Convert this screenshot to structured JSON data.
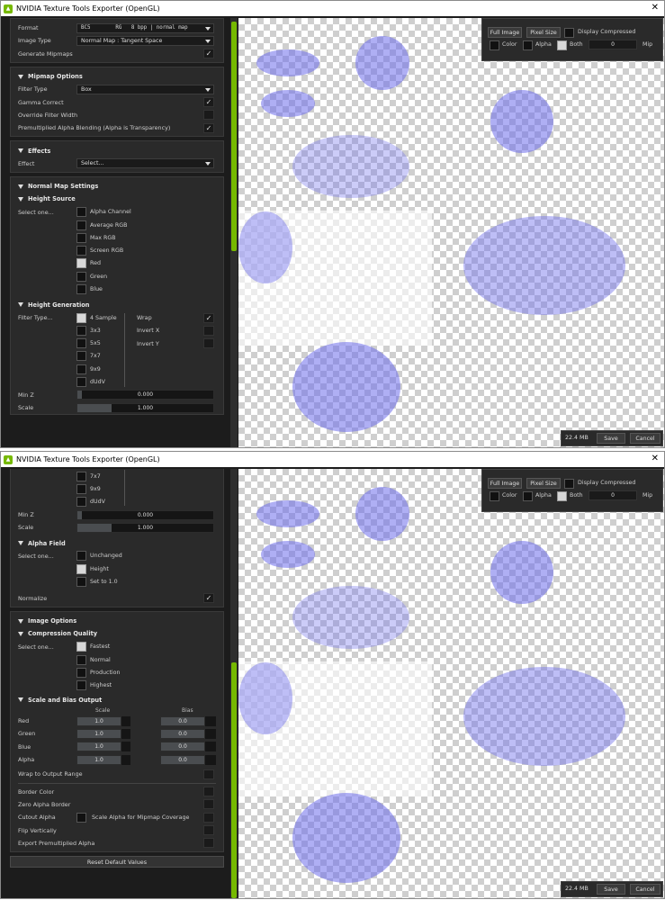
{
  "title": "NVIDIA Texture Tools Exporter (OpenGL)",
  "close": "✕",
  "nv_logo": "nvidia-logo",
  "accent": "#76b900",
  "tint": "#6e6eeb",
  "win1": {
    "format": {
      "label": "Format",
      "value": "BC5        RG   8 bpp | normal map"
    },
    "image_type": {
      "label": "Image Type",
      "value": "Normal Map : Tangent Space"
    },
    "gen_mips": {
      "label": "Generate Mipmaps",
      "check": "✓"
    },
    "mip_header": "Mipmap Options",
    "filter_type": {
      "label": "Filter Type",
      "value": "Box"
    },
    "gamma": {
      "label": "Gamma Correct",
      "check": "✓"
    },
    "override": {
      "label": "Override Filter Width"
    },
    "premult": {
      "label": "Premultiplied Alpha Blending (Alpha is Transparency)",
      "check": "✓"
    },
    "effects_header": "Effects",
    "effect": {
      "label": "Effect",
      "value": "Select..."
    },
    "nm_header": "Normal Map Settings",
    "hs_header": "Height Source",
    "select_one": "Select one...",
    "height_sources": [
      "Alpha Channel",
      "Average RGB",
      "Max RGB",
      "Screen RGB",
      "Red",
      "Green",
      "Blue"
    ],
    "hg_header": "Height Generation",
    "filter_type2": "Filter Type...",
    "filters": [
      "4 Sample",
      "3x3",
      "5x5",
      "7x7",
      "9x9",
      "dUdV"
    ],
    "wrap": "Wrap",
    "wrap_check": "✓",
    "invert_x": "Invert X",
    "invert_y": "Invert Y",
    "minz": {
      "label": "Min Z",
      "value": "0.000",
      "fill": 0.0
    },
    "scale": {
      "label": "Scale",
      "value": "1.000",
      "fill": 0.25
    }
  },
  "win2": {
    "filters": [
      "7x7",
      "9x9",
      "dUdV"
    ],
    "minz": {
      "label": "Min Z",
      "value": "0.000",
      "fill": 0.0
    },
    "scale": {
      "label": "Scale",
      "value": "1.000",
      "fill": 0.25
    },
    "alpha_header": "Alpha Field",
    "select_one": "Select one...",
    "alpha_opts": [
      "Unchanged",
      "Height",
      "Set to 1.0"
    ],
    "normalize": {
      "label": "Normalize",
      "check": "✓"
    },
    "io_header": "Image Options",
    "cq_header": "Compression Quality",
    "quality": [
      "Fastest",
      "Normal",
      "Production",
      "Highest"
    ],
    "sb_header": "Scale and Bias Output",
    "scale_col": "Scale",
    "bias_col": "Bias",
    "channels": [
      {
        "name": "Red",
        "scale": "1.0",
        "bias": "0.0"
      },
      {
        "name": "Green",
        "scale": "1.0",
        "bias": "0.0"
      },
      {
        "name": "Blue",
        "scale": "1.0",
        "bias": "0.0"
      },
      {
        "name": "Alpha",
        "scale": "1.0",
        "bias": "0.0"
      }
    ],
    "wrap_range": "Wrap to Output Range",
    "border_color": "Border Color",
    "zero_alpha": "Zero Alpha Border",
    "cutout": "Cutout Alpha",
    "scale_alpha": "Scale Alpha for Mipmap Coverage",
    "flip": "Flip Vertically",
    "export_premult": "Export Premultiplied Alpha",
    "reset": "Reset Default Values"
  },
  "viewer": {
    "full_image": "Full Image",
    "pixel_size": "Pixel Size",
    "display_compressed": "Display Compressed",
    "color": "Color",
    "alpha": "Alpha",
    "both": "Both",
    "mip_value": "0",
    "mip": "Mip",
    "size": "22.4 MB",
    "save": "Save",
    "cancel": "Cancel"
  }
}
